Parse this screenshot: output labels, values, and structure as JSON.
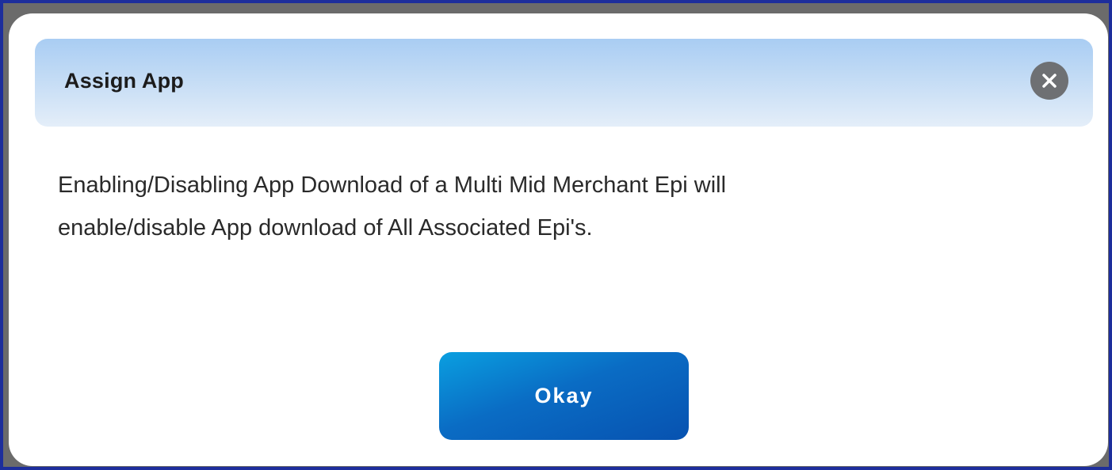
{
  "dialog": {
    "title": "Assign App",
    "message_line1": "Enabling/Disabling App Download of a Multi Mid Merchant Epi will",
    "message_line2": "enable/disable App download of All Associated Epi's.",
    "close_icon": "close-circle-icon",
    "okay_label": "Okay"
  },
  "colors": {
    "frame_border": "#1d2e9c",
    "backdrop": "#6b6b6b",
    "header_gradient_top": "#a9cdf3",
    "header_gradient_bottom": "#e4eef9",
    "close_icon_bg": "#6e7073",
    "button_gradient_start": "#0a9fe0",
    "button_gradient_end": "#0752b0"
  }
}
